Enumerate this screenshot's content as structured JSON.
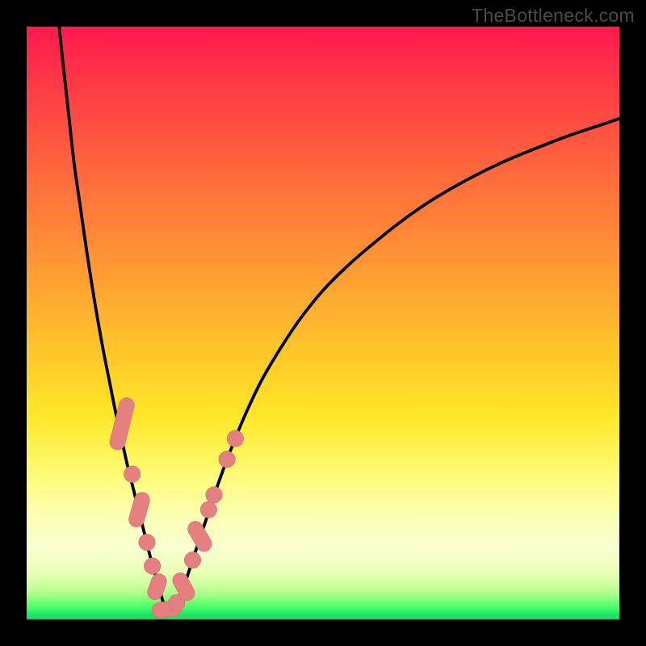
{
  "watermark": "TheBottleneck.com",
  "colors": {
    "curve": "#000000",
    "marker_fill": "#e58080",
    "marker_stroke": "#cf6a6a",
    "frame": "#000000"
  },
  "chart_data": {
    "type": "line",
    "title": "",
    "xlabel": "",
    "ylabel": "",
    "xlim": [
      0,
      100
    ],
    "ylim": [
      0,
      100
    ],
    "series": [
      {
        "name": "left-curve",
        "x": [
          5.5,
          6,
          7,
          8,
          9,
          10,
          11,
          12,
          13,
          14,
          15,
          16,
          17,
          18,
          19,
          20,
          21,
          22,
          23,
          23.5
        ],
        "y": [
          100,
          95,
          86,
          77,
          70,
          63,
          56.5,
          50.5,
          45,
          40,
          35,
          30.5,
          26,
          22,
          18,
          14,
          10,
          6.5,
          3,
          1.5
        ]
      },
      {
        "name": "right-curve",
        "x": [
          23.5,
          24,
          25,
          26,
          27,
          28,
          29,
          30,
          32,
          34,
          36,
          38,
          40,
          43,
          46,
          50,
          54,
          58,
          63,
          68,
          74,
          80,
          86,
          92,
          98,
          100
        ],
        "y": [
          1.5,
          1.5,
          2.5,
          4.5,
          7,
          10,
          13,
          16,
          22,
          27.5,
          32.5,
          37,
          41,
          46,
          50.5,
          55.5,
          59.5,
          63,
          67,
          70.5,
          74,
          77,
          79.5,
          81.8,
          83.8,
          84.5
        ]
      }
    ],
    "markers": [
      {
        "shape": "capsule",
        "cx": 16.1,
        "cy": 33.0,
        "len": 9.0,
        "angle": 76
      },
      {
        "shape": "dot",
        "cx": 17.8,
        "cy": 24.5,
        "r": 1.4
      },
      {
        "shape": "capsule",
        "cx": 19.0,
        "cy": 18.5,
        "len": 6.0,
        "angle": 74
      },
      {
        "shape": "dot",
        "cx": 20.3,
        "cy": 13.0,
        "r": 1.4
      },
      {
        "shape": "dot",
        "cx": 21.2,
        "cy": 9.0,
        "r": 1.4
      },
      {
        "shape": "capsule",
        "cx": 22.0,
        "cy": 5.5,
        "len": 4.5,
        "angle": 70
      },
      {
        "shape": "capsule",
        "cx": 23.6,
        "cy": 1.7,
        "len": 5.0,
        "angle": 8
      },
      {
        "shape": "dot",
        "cx": 25.3,
        "cy": 2.8,
        "r": 1.4
      },
      {
        "shape": "capsule",
        "cx": 26.5,
        "cy": 5.5,
        "len": 5.0,
        "angle": -62
      },
      {
        "shape": "dot",
        "cx": 28.0,
        "cy": 10.0,
        "r": 1.4
      },
      {
        "shape": "capsule",
        "cx": 29.2,
        "cy": 14.0,
        "len": 5.5,
        "angle": -60
      },
      {
        "shape": "dot",
        "cx": 30.7,
        "cy": 18.5,
        "r": 1.4
      },
      {
        "shape": "dot",
        "cx": 31.6,
        "cy": 21.0,
        "r": 1.4
      },
      {
        "shape": "dot",
        "cx": 33.8,
        "cy": 27.0,
        "r": 1.4
      },
      {
        "shape": "dot",
        "cx": 35.2,
        "cy": 30.5,
        "r": 1.4
      }
    ]
  }
}
